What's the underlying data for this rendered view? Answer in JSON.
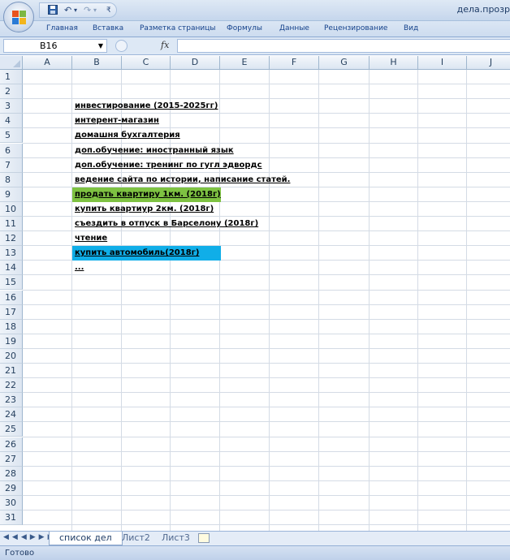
{
  "window": {
    "title": "дела.прозр"
  },
  "qat": {
    "save_icon": "save-icon",
    "undo_icon": "undo-icon",
    "redo_icon": "redo-icon",
    "customize_icon": "dropdown-icon"
  },
  "ribbon": {
    "tabs": [
      "Главная",
      "Вставка",
      "Разметка страницы",
      "Формулы",
      "Данные",
      "Рецензирование",
      "Вид"
    ]
  },
  "formula_bar": {
    "name_box": "B16",
    "fx_label": "fx",
    "value": ""
  },
  "grid": {
    "columns": [
      "A",
      "B",
      "C",
      "D",
      "E",
      "F",
      "G",
      "H",
      "I",
      "J"
    ],
    "rows": [
      "1",
      "2",
      "3",
      "4",
      "5",
      "6",
      "7",
      "8",
      "9",
      "10",
      "11",
      "12",
      "13",
      "14",
      "15",
      "16",
      "17",
      "18",
      "19",
      "20",
      "21",
      "22",
      "23",
      "24",
      "25",
      "26",
      "27",
      "28",
      "29",
      "30",
      "31"
    ],
    "cells": [
      {
        "row": 3,
        "text": "инвестирование (2015-2025гг)"
      },
      {
        "row": 4,
        "text": "интерент-магазин"
      },
      {
        "row": 5,
        "text": "домашня бухгалтерия"
      },
      {
        "row": 6,
        "text": "доп.обучение: иностранный язык"
      },
      {
        "row": 7,
        "text": "доп.обучение: тренинг по гугл эдвордс"
      },
      {
        "row": 8,
        "text": "ведение сайта по истории, написание статей."
      },
      {
        "row": 9,
        "text": "продать квартиру 1км. (2018г)",
        "fill": "#7ec242"
      },
      {
        "row": 10,
        "text": "купить квартиур 2км. (2018г)"
      },
      {
        "row": 11,
        "text": "съездить в отпуск в Барселону (2018г)"
      },
      {
        "row": 12,
        "text": "чтение"
      },
      {
        "row": 13,
        "text": "купить автомобиль(2018г)",
        "fill": "#10aee8"
      },
      {
        "row": 14,
        "text": "..."
      }
    ]
  },
  "sheets": {
    "tabs": [
      "список дел",
      "Лист2",
      "Лист3"
    ],
    "active": 0
  },
  "status": {
    "text": "Готово"
  },
  "colors": {
    "green_fill": "#7ec242",
    "blue_fill": "#10aee8",
    "ribbon": "#dbe6f4"
  }
}
